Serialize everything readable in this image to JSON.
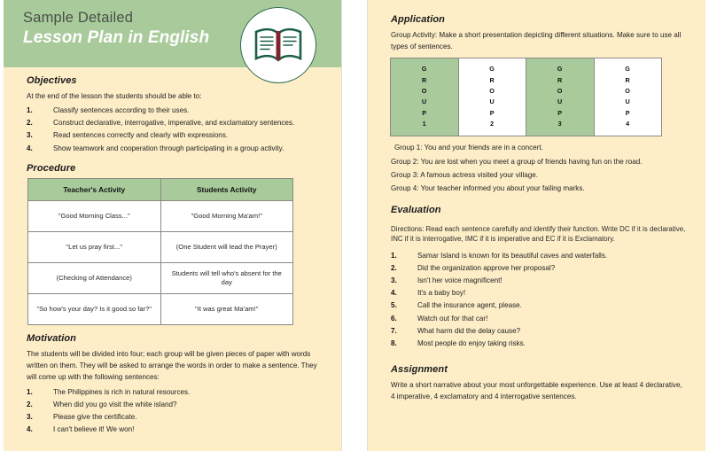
{
  "header": {
    "subtitle": "Sample Detailed",
    "title": "Lesson Plan in English",
    "badge_icon": "open-book-icon",
    "band_color": "#a9cb9c",
    "page_color": "#fdeec8"
  },
  "left_page": {
    "objectives": {
      "heading": "Objectives",
      "intro": "At the end of the lesson the students should be able to:",
      "items": [
        {
          "num": "1.",
          "text": "Classify sentences according to their uses."
        },
        {
          "num": "2.",
          "text": "Construct declarative, interrogative, imperative, and exclamatory sentences."
        },
        {
          "num": "3.",
          "text": "Read sentences correctly and clearly with expressions."
        },
        {
          "num": "4.",
          "text": "Show teamwork and cooperation through participating in a group activity."
        }
      ]
    },
    "procedure": {
      "heading": "Procedure",
      "columns": [
        "Teacher's Activity",
        "Students Activity"
      ],
      "rows": [
        [
          "\"Good Morning Class...\"",
          "\"Good Morning Ma'am!\""
        ],
        [
          "\"Let us pray first...\"",
          "(One Student will lead the Prayer)"
        ],
        [
          "(Checking of Attendance)",
          "Students will tell who's absent for the day"
        ],
        [
          "\"So how's your day? Is it good so far?\"",
          "\"It was great Ma'am!\""
        ]
      ]
    },
    "motivation": {
      "heading": "Motivation",
      "paragraph": "The students will be divided into four; each group will be given pieces of paper with words written on them. They will be asked to arrange the words in order to make a sentence. They will come up with the following sentences:",
      "items": [
        {
          "num": "1.",
          "text": "The Philippines is rich in natural resources."
        },
        {
          "num": "2.",
          "text": "When did you go visit the white island?"
        },
        {
          "num": "3.",
          "text": "Please give the certificate."
        },
        {
          "num": "4.",
          "text": "I can't believe it! We won!"
        }
      ]
    }
  },
  "right_page": {
    "application": {
      "heading": "Application",
      "paragraph": "Group Activity: Make a short presentation depicting different situations. Make sure to use all types of sentences.",
      "group_boxes": [
        {
          "label": "G R O U P 1",
          "letters": [
            "G",
            "R",
            "O",
            "U",
            "P",
            "1"
          ],
          "shade": "green"
        },
        {
          "label": "G R O U P 2",
          "letters": [
            "G",
            "R",
            "O",
            "U",
            "P",
            "2"
          ],
          "shade": "white"
        },
        {
          "label": "G R O U P 3",
          "letters": [
            "G",
            "R",
            "O",
            "U",
            "P",
            "3"
          ],
          "shade": "green"
        },
        {
          "label": "G R O U P 4",
          "letters": [
            "G",
            "R",
            "O",
            "U",
            "P",
            "4"
          ],
          "shade": "white"
        }
      ],
      "group_lines": [
        "Group 1: You and your friends are in a concert.",
        "Group 2: You are lost when you meet a group of friends having fun on the road.",
        "Group 3: A famous actress visited your village.",
        "Group 4: Your teacher informed you about your failing marks."
      ]
    },
    "evaluation": {
      "heading": "Evaluation",
      "directions": "Directions: Read each sentence carefully and identify their function. Write DC if it is declarative, INC if it is interrogative, IMC if it is imperative and EC if it is Exclamatory.",
      "items": [
        {
          "num": "1.",
          "text": "Samar Island is known for its beautiful caves and waterfalls."
        },
        {
          "num": "2.",
          "text": "Did the organization approve her proposal?"
        },
        {
          "num": "3.",
          "text": "Isn't her voice magnificent!"
        },
        {
          "num": "4.",
          "text": "It's a baby boy!"
        },
        {
          "num": "5.",
          "text": "Call the insurance agent, please."
        },
        {
          "num": "6.",
          "text": "Watch out for that car!"
        },
        {
          "num": "7.",
          "text": "What harm did the delay cause?"
        },
        {
          "num": "8.",
          "text": "Most people do enjoy taking risks."
        }
      ]
    },
    "assignment": {
      "heading": "Assignment",
      "paragraph": "Write a short narrative about your most unforgettable experience. Use at least 4 declarative, 4 imperative, 4 exclamatory and 4 interrogative sentences."
    }
  }
}
